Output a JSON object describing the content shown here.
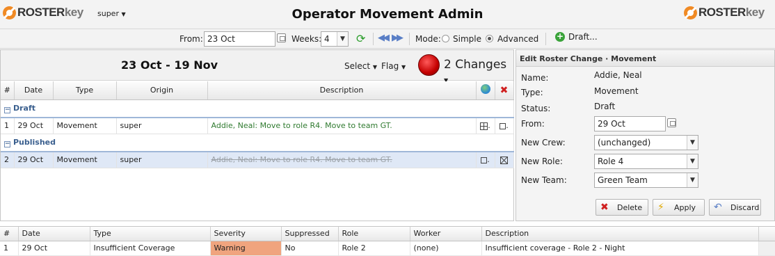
{
  "header": {
    "logo_left": {
      "part1": "ROSTER",
      "part2": "key"
    },
    "logo_right": {
      "part1": "ROSTER",
      "part2": "key"
    },
    "user": "super",
    "title": "Operator Movement Admin"
  },
  "toolbar": {
    "from_label": "From:",
    "from_value": "23 Oct",
    "weeks_label": "Weeks:",
    "weeks_value": "4",
    "mode_label": "Mode:",
    "mode_simple": "Simple",
    "mode_advanced": "Advanced",
    "mode_selected": "Advanced",
    "draft_label": "Draft..."
  },
  "grid": {
    "range_title": "23 Oct - 19 Nov",
    "select_menu": "Select",
    "flag_menu": "Flag",
    "changes_label": "2 Changes",
    "columns": [
      "#",
      "Date",
      "Type",
      "Origin",
      "Description"
    ],
    "groups": [
      {
        "name": "Draft",
        "rows": [
          {
            "num": "1",
            "date": "29 Oct",
            "type": "Movement",
            "origin": "super",
            "description": "Addie, Neal: Move to role R4. Move to team GT."
          }
        ]
      },
      {
        "name": "Published",
        "rows": [
          {
            "num": "2",
            "date": "29 Oct",
            "type": "Movement",
            "origin": "super",
            "description": "Addie, Neal: Move to role R4. Move to team GT."
          }
        ]
      }
    ]
  },
  "edit_panel": {
    "title": "Edit Roster Change · Movement",
    "name_label": "Name:",
    "name_value": "Addie, Neal",
    "type_label": "Type:",
    "type_value": "Movement",
    "status_label": "Status:",
    "status_value": "Draft",
    "from_label": "From:",
    "from_value": "29 Oct",
    "new_crew_label": "New Crew:",
    "new_crew_value": "(unchanged)",
    "new_role_label": "New Role:",
    "new_role_value": "Role 4",
    "new_team_label": "New Team:",
    "new_team_value": "Green Team",
    "delete_label": "Delete",
    "apply_label": "Apply",
    "discard_label": "Discard"
  },
  "issues": {
    "columns": [
      "#",
      "Date",
      "Type",
      "Severity",
      "Suppressed",
      "Role",
      "Worker",
      "Description"
    ],
    "rows": [
      {
        "num": "1",
        "date": "29 Oct",
        "type": "Insufficient Coverage",
        "severity": "Warning",
        "suppressed": "No",
        "role": "Role 2",
        "worker": "(none)",
        "description": "Insufficient coverage - Role 2 - Night"
      }
    ]
  },
  "colors": {
    "accent_orange": "#f08a24",
    "warning": "#f0a47e",
    "draft_green": "#2f7a2f",
    "group_blue": "#3a5f8e"
  }
}
